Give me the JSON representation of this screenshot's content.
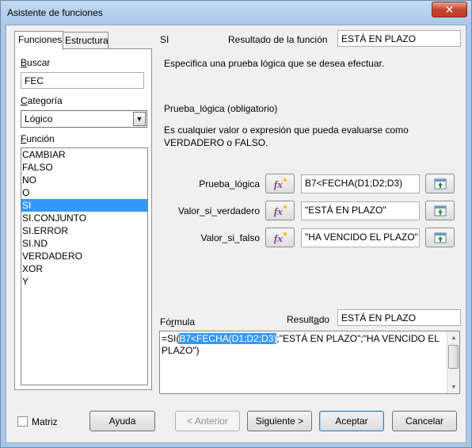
{
  "window": {
    "title": "Asistente de funciones",
    "close_glyph": "✕"
  },
  "tabs": [
    {
      "label": "Funciones"
    },
    {
      "label": "Estructura"
    }
  ],
  "search": {
    "label": "Buscar",
    "value": "FEC"
  },
  "category": {
    "label": "Categoría",
    "value": "Lógico"
  },
  "function_list": {
    "label": "Función",
    "items": [
      "CAMBIAR",
      "FALSO",
      "NO",
      "O",
      "SI",
      "SI.CONJUNTO",
      "SI.ERROR",
      "SI.ND",
      "VERDADERO",
      "XOR",
      "Y"
    ],
    "selected": "SI"
  },
  "function_info": {
    "name": "SI",
    "result_label": "Resultado de la función",
    "result_value": "ESTÁ EN PLAZO",
    "description": "Especifica una prueba lógica que se desea efectuar.",
    "param_title": "Prueba_lógica (obligatorio)",
    "param_description": "Es cualquier valor o expresión que pueda evaluarse como VERDADERO o FALSO."
  },
  "arguments": [
    {
      "label": "Prueba_lógica",
      "value": "B7<FECHA(D1;D2;D3)"
    },
    {
      "label": "Valor_si_verdadero",
      "value": "\"ESTÁ EN PLAZO\""
    },
    {
      "label": "Valor_si_falso",
      "value": "\"HA VENCIDO EL PLAZO\""
    }
  ],
  "formula": {
    "label": "Fórmula",
    "result_label": "Resultado",
    "result_value": "ESTÁ EN PLAZO",
    "prefix": "=SI(",
    "highlight": "B7<FECHA(D1;D2;D3)",
    "suffix": ";\"ESTÁ EN PLAZO\";\"HA VENCIDO EL PLAZO\")"
  },
  "footer": {
    "matrix_label": "Matriz",
    "help_label": "Ayuda",
    "back_label": "< Anterior",
    "next_label": "Siguiente >",
    "ok_label": "Aceptar",
    "cancel_label": "Cancelar"
  },
  "colors": {
    "selection": "#3399ff",
    "title_bar": "#a9c8e8",
    "close_button": "#c8452c"
  },
  "icons": {
    "fx": "fx-icon",
    "pick": "shrink-select-icon"
  }
}
